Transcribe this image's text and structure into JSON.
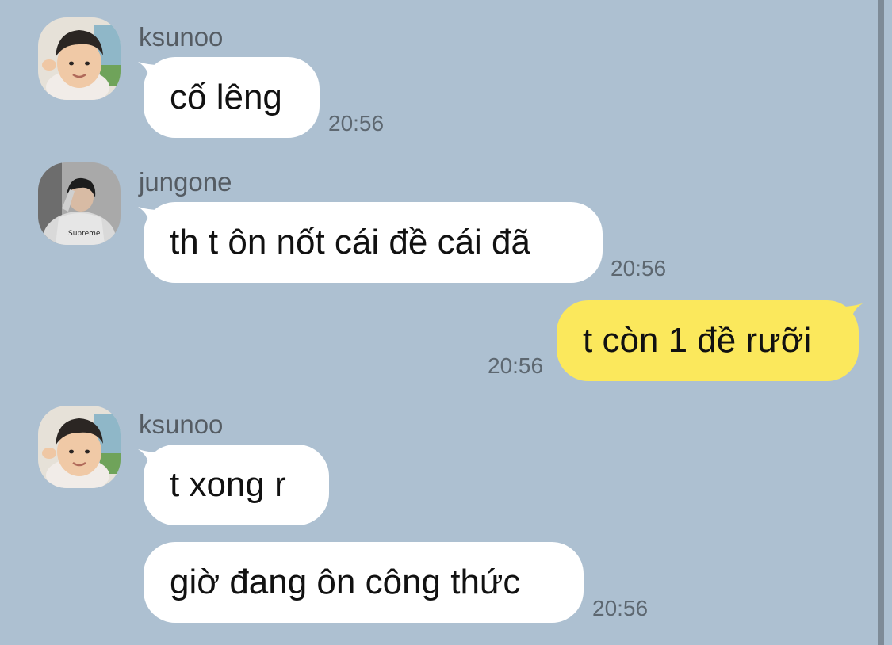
{
  "messages": [
    {
      "sender": "ksunoo",
      "text": "cố lêng",
      "time": "20:56"
    },
    {
      "sender": "jungone",
      "text": "th t ôn nốt cái đề cái đã",
      "time": "20:56"
    },
    {
      "sender": "",
      "text": "t còn 1 đề rưỡi",
      "time": "20:56"
    },
    {
      "sender": "ksunoo",
      "text": "t xong r",
      "time": ""
    },
    {
      "sender": "",
      "text": "giờ đang ôn công thức",
      "time": "20:56"
    }
  ],
  "colors": {
    "background": "#adc0d1",
    "incoming_bubble": "#ffffff",
    "outgoing_bubble": "#fbe85c",
    "timestamp": "#5d6770"
  },
  "icons": {
    "avatar_ksunoo": "child-photo-avatar",
    "avatar_jungone": "boy-photo-avatar"
  }
}
